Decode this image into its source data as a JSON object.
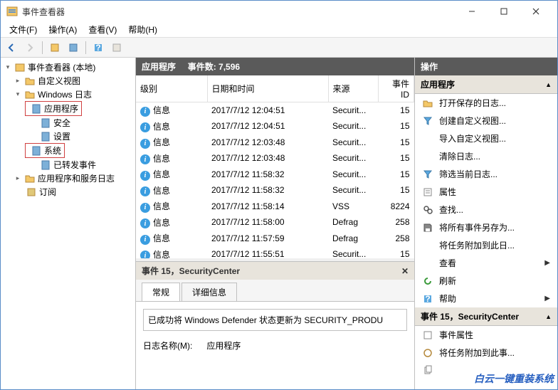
{
  "window": {
    "title": "事件查看器"
  },
  "menu": {
    "file": "文件(F)",
    "action": "操作(A)",
    "view": "查看(V)",
    "help": "帮助(H)"
  },
  "tree": {
    "root": "事件查看器 (本地)",
    "custom_views": "自定义视图",
    "windows_logs": "Windows 日志",
    "application": "应用程序",
    "security": "安全",
    "setup": "设置",
    "system": "系统",
    "forwarded": "已转发事件",
    "app_services": "应用程序和服务日志",
    "subscriptions": "订阅"
  },
  "list_header": {
    "title": "应用程序",
    "count_label": "事件数: 7,596"
  },
  "columns": {
    "level": "级别",
    "datetime": "日期和时间",
    "source": "来源",
    "event_id": "事件 ID"
  },
  "info_label": "信息",
  "events": [
    {
      "dt": "2017/7/12 12:04:51",
      "src": "Securit...",
      "id": "15"
    },
    {
      "dt": "2017/7/12 12:04:51",
      "src": "Securit...",
      "id": "15"
    },
    {
      "dt": "2017/7/12 12:03:48",
      "src": "Securit...",
      "id": "15"
    },
    {
      "dt": "2017/7/12 12:03:48",
      "src": "Securit...",
      "id": "15"
    },
    {
      "dt": "2017/7/12 11:58:32",
      "src": "Securit...",
      "id": "15"
    },
    {
      "dt": "2017/7/12 11:58:32",
      "src": "Securit...",
      "id": "15"
    },
    {
      "dt": "2017/7/12 11:58:14",
      "src": "VSS",
      "id": "8224"
    },
    {
      "dt": "2017/7/12 11:58:00",
      "src": "Defrag",
      "id": "258"
    },
    {
      "dt": "2017/7/12 11:57:59",
      "src": "Defrag",
      "id": "258"
    },
    {
      "dt": "2017/7/12 11:55:51",
      "src": "Securit...",
      "id": "15"
    }
  ],
  "detail": {
    "header": "事件 15，SecurityCenter",
    "tab_general": "常规",
    "tab_details": "详细信息",
    "message": "已成功将 Windows Defender 状态更新为 SECURITY_PRODU",
    "log_name_label": "日志名称(M):",
    "log_name_value": "应用程序"
  },
  "actions": {
    "header": "操作",
    "section1": "应用程序",
    "open_saved": "打开保存的日志...",
    "create_custom": "创建自定义视图...",
    "import_custom": "导入自定义视图...",
    "clear_log": "清除日志...",
    "filter": "筛选当前日志...",
    "properties": "属性",
    "find": "查找...",
    "save_all": "将所有事件另存为...",
    "attach_task": "将任务附加到此日...",
    "view": "查看",
    "refresh": "刷新",
    "help": "帮助",
    "section2": "事件 15，SecurityCenter",
    "event_props": "事件属性",
    "attach_evt": "将任务附加到此事..."
  },
  "watermark": "白云一键重装系统"
}
